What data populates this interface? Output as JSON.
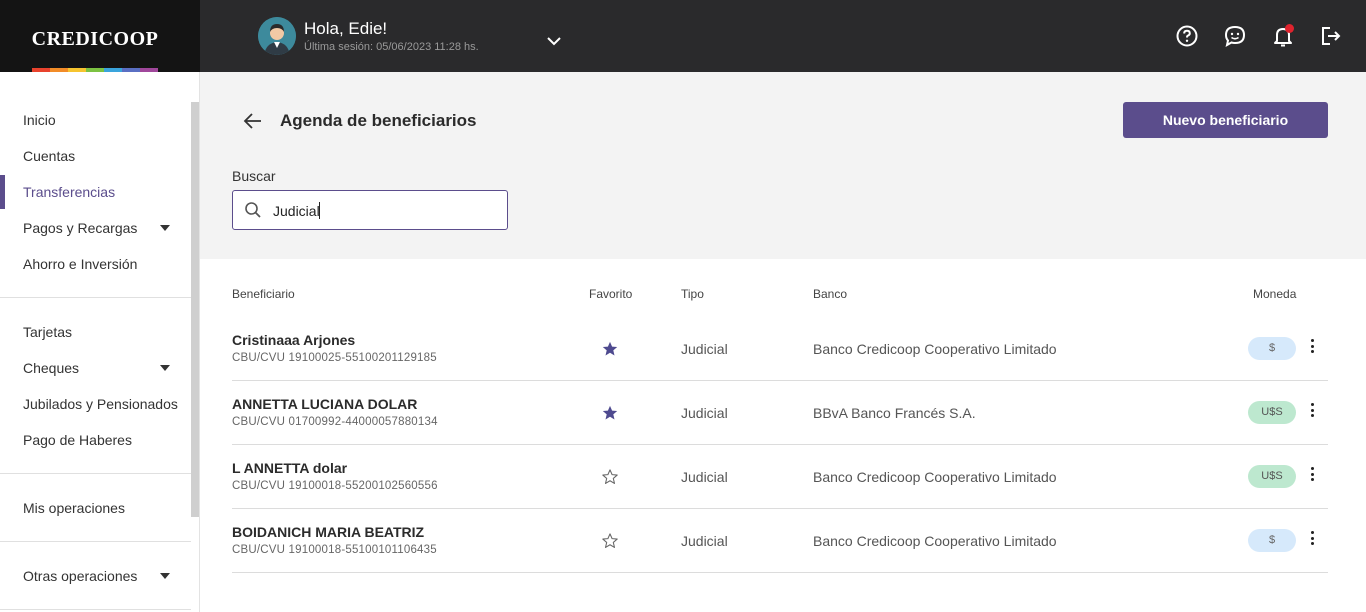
{
  "brand": {
    "name": "CREDICOOP",
    "stripe_colors": [
      "#e8432d",
      "#f28c28",
      "#f6c42f",
      "#7cc242",
      "#3aa4dc",
      "#5a6fc3",
      "#a0479b"
    ]
  },
  "user": {
    "greeting": "Hola, Edie!",
    "last_session": "Última sesión: 05/06/2023 11:28 hs."
  },
  "topbar_icons": [
    "help-icon",
    "chat-icon",
    "bell-icon",
    "logout-icon"
  ],
  "sidebar": {
    "items": [
      {
        "label": "Inicio"
      },
      {
        "label": "Cuentas"
      },
      {
        "label": "Transferencias",
        "active": true
      },
      {
        "label": "Pagos y Recargas",
        "expandable": true
      },
      {
        "label": "Ahorro e Inversión"
      },
      {
        "label": "Tarjetas"
      },
      {
        "label": "Cheques",
        "expandable": true
      },
      {
        "label": "Jubilados y Pensionados"
      },
      {
        "label": "Pago de Haberes"
      },
      {
        "label": "Mis operaciones"
      },
      {
        "label": "Otras operaciones",
        "expandable": true
      }
    ]
  },
  "page": {
    "title": "Agenda de beneficiarios",
    "new_button": "Nuevo beneficiario",
    "search_label": "Buscar",
    "search_value": "Judicial"
  },
  "table": {
    "headers": {
      "beneficiario": "Beneficiario",
      "favorito": "Favorito",
      "tipo": "Tipo",
      "banco": "Banco",
      "moneda": "Moneda"
    },
    "rows": [
      {
        "name": "Cristinaaa Arjones",
        "cbu": "CBU/CVU 19100025-55100201129185",
        "favorite": true,
        "tipo": "Judicial",
        "banco": "Banco Credicoop Cooperativo Limitado",
        "moneda": "$"
      },
      {
        "name": "ANNETTA LUCIANA DOLAR",
        "cbu": "CBU/CVU 01700992-44000057880134",
        "favorite": true,
        "tipo": "Judicial",
        "banco": "BBvA Banco Francés S.A.",
        "moneda": "U$S"
      },
      {
        "name": "L ANNETTA dolar",
        "cbu": "CBU/CVU 19100018-55200102560556",
        "favorite": false,
        "tipo": "Judicial",
        "banco": "Banco Credicoop Cooperativo Limitado",
        "moneda": "U$S"
      },
      {
        "name": "BOIDANICH MARIA BEATRIZ",
        "cbu": "CBU/CVU 19100018-55100101106435",
        "favorite": false,
        "tipo": "Judicial",
        "banco": "Banco Credicoop Cooperativo Limitado",
        "moneda": "$"
      }
    ]
  },
  "colors": {
    "accent": "#5b4d8c",
    "topbar": "#2a2a2c",
    "pesos_badge": "#d6e9fb",
    "dolar_badge": "#bde8cf",
    "notification": "#e0232e"
  }
}
